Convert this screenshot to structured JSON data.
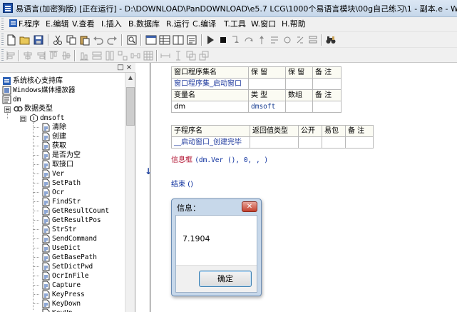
{
  "window": {
    "title": "易语言(加密狗版) [正在运行] - D:\\DOWNLOAD\\PanDOWNLOAD\\e5.7 LCG\\1000个易语言模块\\00g自己练习\\1 - 副本.e - Win"
  },
  "menu": {
    "items": [
      {
        "label": "F.程序"
      },
      {
        "label": "E.编辑"
      },
      {
        "label": "V.查看"
      },
      {
        "label": "I.插入"
      },
      {
        "label": "B.数据库"
      },
      {
        "label": "R.运行"
      },
      {
        "label": "C.编译"
      },
      {
        "label": "T.工具"
      },
      {
        "label": "W.窗口"
      },
      {
        "label": "H.帮助"
      }
    ]
  },
  "panel": {
    "pin_glyph": "□",
    "close_glyph": "×"
  },
  "tree": {
    "roots": [
      {
        "label": "系统核心支持库"
      },
      {
        "label": "Windows媒体播放器"
      },
      {
        "label": "dm"
      },
      {
        "label": "数据类型",
        "expander": "⊟"
      },
      {
        "label": "dmsoft",
        "expander": "⊟"
      }
    ],
    "methods": [
      "清除",
      "创建",
      "获取",
      "是否为空",
      "取接口",
      "Ver",
      "SetPath",
      "Ocr",
      "FindStr",
      "GetResultCount",
      "GetResultPos",
      "StrStr",
      "SendCommand",
      "UseDict",
      "GetBasePath",
      "SetDictPwd",
      "OcrInFile",
      "Capture",
      "KeyPress",
      "KeyDown",
      "KeyUp"
    ]
  },
  "editor": {
    "assembly_table": {
      "headers": [
        "窗口程序集名",
        "保 留",
        "保 留",
        "备 注"
      ],
      "row": [
        "窗口程序集_启动窗口",
        "",
        "",
        ""
      ]
    },
    "var_table": {
      "headers": [
        "变量名",
        "类 型",
        "数组",
        "备 注"
      ],
      "row": [
        "dm",
        "dmsoft",
        "",
        ""
      ]
    },
    "sub_table": {
      "headers": [
        "子程序名",
        "返回值类型",
        "公开",
        "易包",
        "备 注"
      ],
      "row": [
        "__启动窗口_创建完毕",
        "",
        "",
        "",
        ""
      ]
    },
    "code": {
      "line1_func": "信息框",
      "line1_args": "(dm.Ver (), 0, , )",
      "line2": "结束 ()"
    },
    "exec_arrow": "↓"
  },
  "dialog": {
    "title": "信息：",
    "close": "✕",
    "message": "7.1904",
    "ok": "确定"
  },
  "colors": {
    "blue_text": "#1f3a9e",
    "keyword_red": "#b0102f",
    "dialog_frame": "#c7d8ea"
  }
}
